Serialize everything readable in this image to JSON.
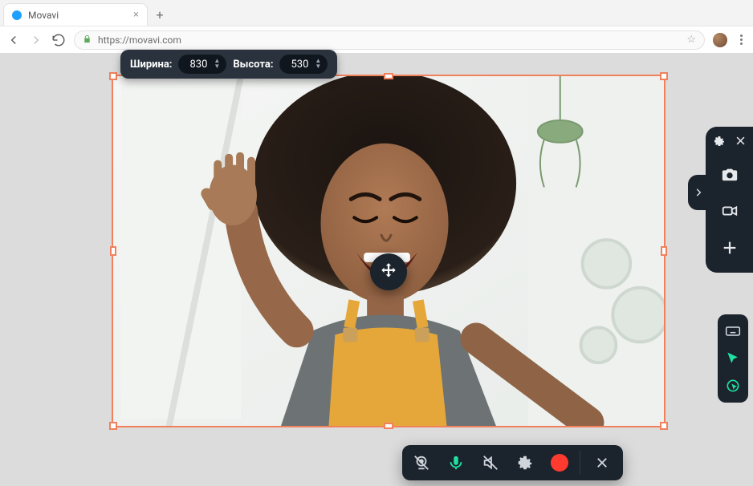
{
  "browser": {
    "tab_title": "Movavi",
    "url_display": "https://movavi.com",
    "nav": {
      "back": "back-icon",
      "forward": "forward-icon",
      "reload": "reload-icon",
      "secure": "lock-icon",
      "star": "star-icon",
      "menu": "kebab-icon"
    }
  },
  "capture": {
    "width_label": "Ширина:",
    "width_value": "830",
    "height_label": "Высота:",
    "height_value": "530",
    "accent": "#f0815c"
  },
  "side_panel": {
    "items": {
      "settings": "gear-icon",
      "close": "close-icon",
      "screenshot": "camera-icon",
      "video": "videocam-icon",
      "add": "plus-icon",
      "expand": "chevron-right-icon"
    }
  },
  "mini_strip": {
    "keyboard": "keyboard-icon",
    "cursor": "cursor-icon",
    "click_highlight": "click-ripple-icon"
  },
  "record_bar": {
    "webcam": "webcam-off-icon",
    "mic": "mic-icon",
    "speaker": "speaker-off-icon",
    "settings": "gear-icon",
    "record": "record-icon",
    "close": "close-icon"
  },
  "colors": {
    "panel": "#1b232c",
    "accent_green": "#1fe2a2",
    "record_red": "#ff3b30"
  }
}
